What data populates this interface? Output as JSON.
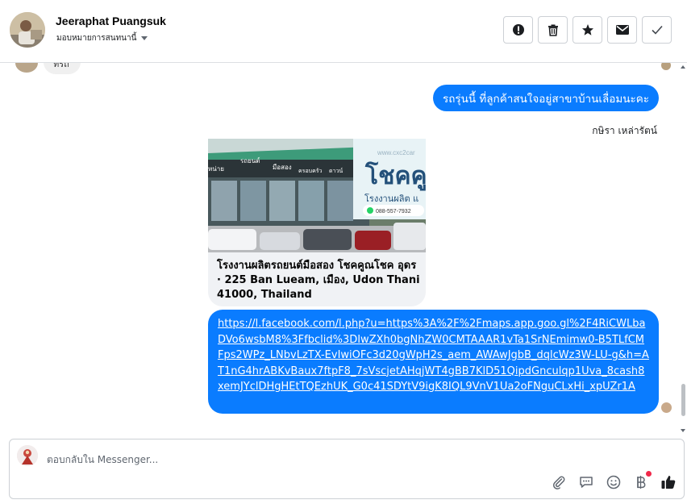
{
  "header": {
    "contact_name": "Jeeraphat Puangsuk",
    "assign_label": "มอบหมายการสนทนานี้",
    "actions": [
      {
        "name": "mark-spam-button",
        "icon": "alert-icon"
      },
      {
        "name": "delete-button",
        "icon": "trash-icon"
      },
      {
        "name": "star-button",
        "icon": "star-icon"
      },
      {
        "name": "mark-unread-button",
        "icon": "envelope-icon"
      },
      {
        "name": "mark-done-button",
        "icon": "check-icon"
      }
    ]
  },
  "messages": {
    "previous_bubble_text": "ทรถ",
    "outgoing_text": "รถรุ่นนี้ ที่ลูกค้าสนใจอยู่สาขาบ้านเลื่อมนะคะ",
    "sender_name": "กษิรา เหล่ารัตน์",
    "card": {
      "image_banner_text": "โชคคู",
      "image_banner_sub": "โรงงานผลิต แ",
      "image_site_text": "www.cxc2car",
      "image_phone": "088-557-7932",
      "image_sign_labels": [
        "หน่าย",
        "รถยนต์",
        "มือสอง",
        "ครอบครัว",
        "ดาวน์"
      ],
      "location_text": "โรงงานผลิตรถยนต์มือสอง โชคคูณโชค อุดร · 225 Ban Lueam, เมือง, Udon Thani 41000, Thailand"
    },
    "link_url": "https://l.facebook.com/l.php?u=https%3A%2F%2Fmaps.app.goo.gl%2F4RiCWLbaDVo6wsbM8%3Ffbclid%3DIwZXh0bgNhZW0CMTAAAR1vTa1SrNEmimw0-B5TLfCMFps2WPz_LNbvLzTX-EvIwiOFc3d20gWpH2s_aem_AWAwJgbB_dqlcWz3W-LU-g&h=AT1nG4hrABKvBaux7ftpF8_7sVscjetAHqjWT4gBB7KlD51QipdGnculqp1Uva_8cash8xemJYclDHgHEtTQEzhUK_G0c41SDYtV9igK8IQL9VnV1Ua2oFNguCLxHi_xpUZr1A"
  },
  "composer": {
    "placeholder": "ตอบกลับใน Messenger...",
    "tools": [
      "paperclip-icon",
      "saved-reply-icon",
      "emoji-icon",
      "baht-payment-icon",
      "thumbs-up-icon"
    ]
  },
  "colors": {
    "accent": "#0a7cff",
    "bubble_gray": "#f0f2f5",
    "notification_dot": "#f02849"
  }
}
